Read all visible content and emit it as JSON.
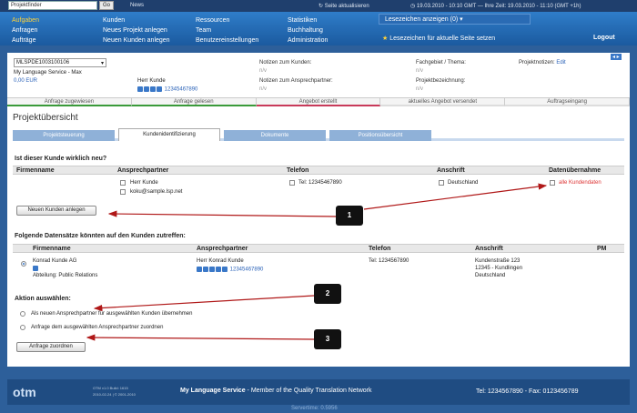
{
  "topbar": {
    "finder_value": "Projektfinder",
    "go_label": "Go",
    "news": "News",
    "refresh": "Seite aktualisieren",
    "time": "19.03.2010 - 10:10 GMT — Ihre Zeit: 19.03.2010 - 11:10 (GMT +1h)"
  },
  "menu": {
    "col1": [
      "Aufgaben",
      "Anfragen",
      "Aufträge"
    ],
    "col2": [
      "Kunden",
      "Neues Projekt anlegen",
      "Neuen Kunden anlegen"
    ],
    "col3": [
      "Ressourcen",
      "Team",
      "Benutzereinstellungen"
    ],
    "col4": [
      "Statistiken",
      "Buchhaltung",
      "Administration"
    ],
    "bookmarks_select": "Lesezeichen anzeigen (0)",
    "bookmark_set": "Lesezeichen für aktuelle Seite setzen",
    "logout": "Logout"
  },
  "project": {
    "select": "MLSPDE1003100106",
    "company": "My Language Service - Max",
    "amount": "0,00 EUR",
    "customer": "Herr Kunde",
    "phone": "12345467890",
    "notes_customer_label": "Notizen zum Kunden:",
    "notes_customer_value": "n/v",
    "notes_contact_label": "Notizen zum Ansprechpartner:",
    "notes_contact_value": "n/v",
    "field_label": "Fachgebiet / Thema:",
    "field_value": "n/v",
    "designation_label": "Projektbezeichnung:",
    "designation_value": "n/v",
    "pnotes_label": "Projektnotizen:",
    "pnotes_edit": "Edit"
  },
  "status_steps": [
    "Anfrage zugewiesen",
    "Anfrage gelesen",
    "Angebot erstellt",
    "aktuelles Angebot versendet",
    "Auftragseingang"
  ],
  "page_title": "Projektübersicht",
  "tabs": [
    "Projektsteuerung",
    "Kundenidentifizierung",
    "Dokumente",
    "Positionsübersicht"
  ],
  "section1": {
    "title": "Ist dieser Kunde wirklich neu?",
    "headers": [
      "Firmenname",
      "Ansprechpartner",
      "Telefon",
      "Anschrift",
      "Datenübernahme"
    ],
    "contact": "Herr Kunde",
    "email": "koku@sample.lsp.net",
    "phone": "Tel: 12345467890",
    "country": "Deutschland",
    "take_all": "alle Kundendaten",
    "new_button": "Neuen Kunden anlegen"
  },
  "section2": {
    "title": "Folgende Datensätze könnten auf den Kunden zutreffen:",
    "headers": [
      "Firmenname",
      "Ansprechpartner",
      "Telefon",
      "Anschrift",
      "PM"
    ],
    "company": "Konrad Kunde AG",
    "dept": "Abteilung: Public Relations",
    "contact": "Herr Konrad Kunde",
    "contact_phone": "12345467890",
    "phone": "Tel: 1234567890",
    "street": "Kundenstraße 123",
    "city": "12345 - Kundlingen",
    "country": "Deutschland"
  },
  "action": {
    "title": "Aktion auswählen:",
    "opt1": "Als neuen Ansprechpartner für ausgewählten Kunden übernehmen",
    "opt2": "Anfrage dem ausgewählten Ansprechpartner zuordnen",
    "button": "Anfrage zuordnen"
  },
  "callouts": [
    "1",
    "2",
    "3"
  ],
  "footer": {
    "logo": "otm",
    "version": "OTM v1.0 Build: 1615",
    "copyright": "2010-02-24 | © 2001-2010",
    "company": "My Language Service",
    "tagline": " - Member of the Quality Translation Network",
    "contact": "Tel: 1234567890 - Fax: 0123456789",
    "server": "Servertime: 0.5956"
  },
  "colors": {
    "accent": "#2a62b8",
    "callout": "#111111",
    "arrow": "#b01818",
    "link_red": "#dd3333"
  }
}
